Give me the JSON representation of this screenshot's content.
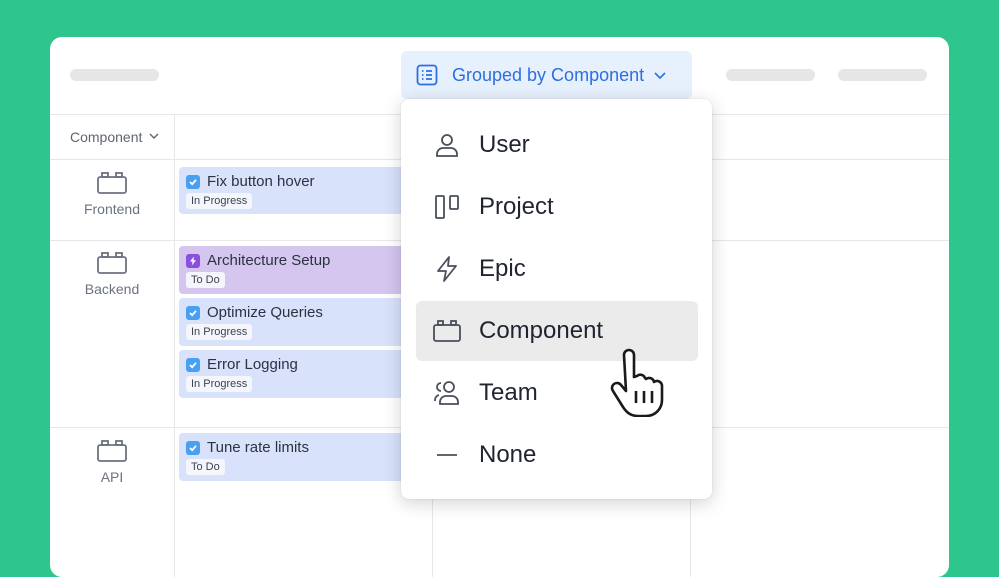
{
  "toolbar": {
    "group_button_label": "Grouped by Component"
  },
  "board": {
    "column_header": "Component",
    "rows": [
      {
        "label": "Frontend",
        "tasks": [
          {
            "title": "Fix button hover",
            "status": "In Progress",
            "type": "task"
          }
        ]
      },
      {
        "label": "Backend",
        "tasks": [
          {
            "title": "Architecture Setup",
            "status": "To Do",
            "type": "epic"
          },
          {
            "title": "Optimize Queries",
            "status": "In Progress",
            "type": "task"
          },
          {
            "title": "Error Logging",
            "status": "In Progress",
            "type": "task"
          }
        ]
      },
      {
        "label": "API",
        "tasks": [
          {
            "title": "Tune rate limits",
            "status": "To Do",
            "type": "task"
          }
        ]
      }
    ]
  },
  "menu": {
    "items": [
      {
        "label": "User",
        "icon": "user-icon"
      },
      {
        "label": "Project",
        "icon": "project-board-icon"
      },
      {
        "label": "Epic",
        "icon": "lightning-icon"
      },
      {
        "label": "Component",
        "icon": "component-box-icon",
        "selected": true
      },
      {
        "label": "Team",
        "icon": "team-icon"
      },
      {
        "label": "None",
        "icon": "dash-icon"
      }
    ]
  },
  "colors": {
    "background": "#2ec68c",
    "accent": "#2c6fe0",
    "task_card": "#d8e2fb",
    "epic_card": "#d4c6ef"
  }
}
